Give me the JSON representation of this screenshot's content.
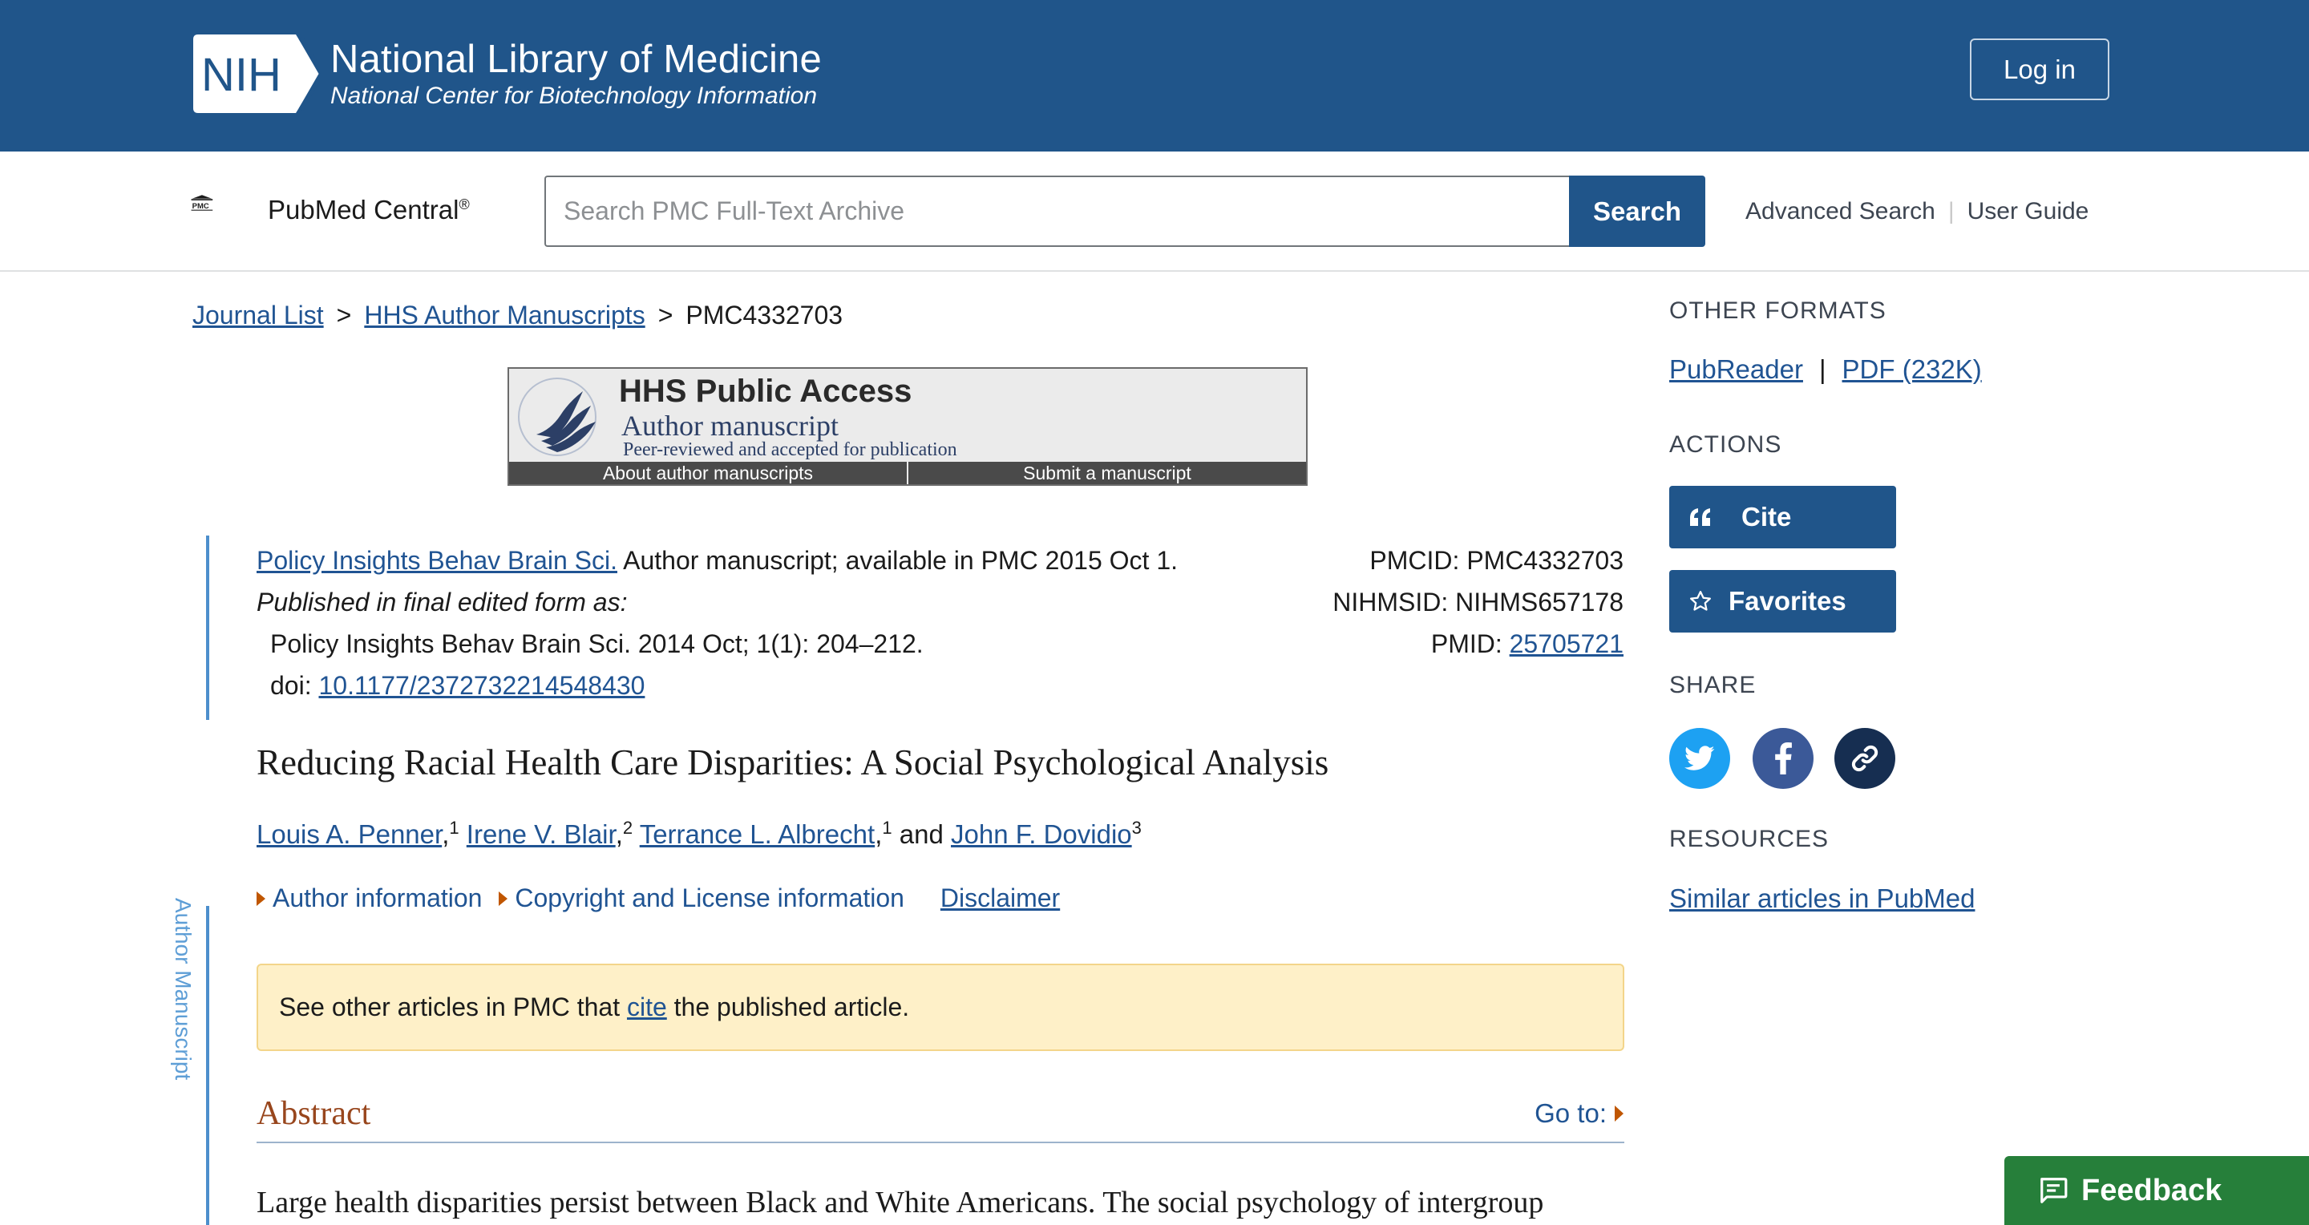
{
  "header": {
    "logo_text": "NIH",
    "title": "National Library of Medicine",
    "subtitle": "National Center for Biotechnology Information",
    "login_label": "Log in"
  },
  "searchbar": {
    "logo_text": "PMC",
    "brand": "PubMed Central",
    "brand_mark": "®",
    "placeholder": "Search PMC Full-Text Archive",
    "search_label": "Search",
    "advanced_label": "Advanced Search",
    "guide_label": "User Guide",
    "separator": "|"
  },
  "breadcrumb": {
    "items": [
      "Journal List",
      "HHS Author Manuscripts"
    ],
    "current": "PMC4332703",
    "separator": ">"
  },
  "hhs_banner": {
    "title": "HHS Public Access",
    "subtitle": "Author manuscript",
    "tagline": "Peer-reviewed and accepted for publication",
    "link1": "About author manuscripts",
    "link2": "Submit a manuscript"
  },
  "side_label": "Author Manuscript",
  "citation": {
    "journal_link": "Policy Insights Behav Brain Sci.",
    "availability": " Author manuscript; available in PMC 2015 Oct 1.",
    "published_label": "Published in final edited form as:",
    "published_ref": "Policy Insights Behav Brain Sci. 2014 Oct; 1(1): 204–212.",
    "doi_label": "doi: ",
    "doi": "10.1177/2372732214548430",
    "pmcid": "PMCID: PMC4332703",
    "nihmsid": "NIHMSID: NIHMS657178",
    "pmid_label": "PMID: ",
    "pmid": "25705721"
  },
  "article": {
    "title": "Reducing Racial Health Care Disparities: A Social Psychological Analysis",
    "authors": [
      {
        "name": "Louis A. Penner",
        "aff": "1"
      },
      {
        "name": "Irene V. Blair",
        "aff": "2"
      },
      {
        "name": "Terrance L. Albrecht",
        "aff": "1"
      },
      {
        "name": "John F. Dovidio",
        "aff": "3"
      }
    ],
    "author_sep": ",",
    "and_word": " and ",
    "author_info_label": "Author information",
    "copyright_label": "Copyright and License information",
    "disclaimer_label": "Disclaimer",
    "notice_pre": "See other articles in PMC that ",
    "notice_link": "cite",
    "notice_post": " the published article.",
    "abstract_heading": "Abstract",
    "goto_label": "Go to:",
    "abstract_text": "Large health disparities persist between Black and White Americans. The social psychology of intergroup"
  },
  "sidebar": {
    "other_formats_heading": "OTHER FORMATS",
    "pubreader": "PubReader",
    "pdf": "PDF (232K)",
    "format_sep": "|",
    "actions_heading": "ACTIONS",
    "cite_label": "Cite",
    "favorites_label": "Favorites",
    "share_heading": "SHARE",
    "resources_heading": "RESOURCES",
    "similar_link": "Similar articles in PubMed"
  },
  "feedback_label": "Feedback",
  "colors": {
    "nih_blue": "#20558a",
    "link_blue": "#205493",
    "accent_orange": "#c05600",
    "twitter": "#1da1f2",
    "facebook": "#3b5998",
    "permalink": "#162e51",
    "feedback_green": "#267f3a",
    "notice_bg": "#fef0c8"
  },
  "icons": [
    "nih-logo-icon",
    "pmc-logo-icon",
    "hhs-seal-icon",
    "quote-icon",
    "star-icon",
    "twitter-icon",
    "facebook-icon",
    "link-icon",
    "comment-icon",
    "triangle-right-icon"
  ]
}
